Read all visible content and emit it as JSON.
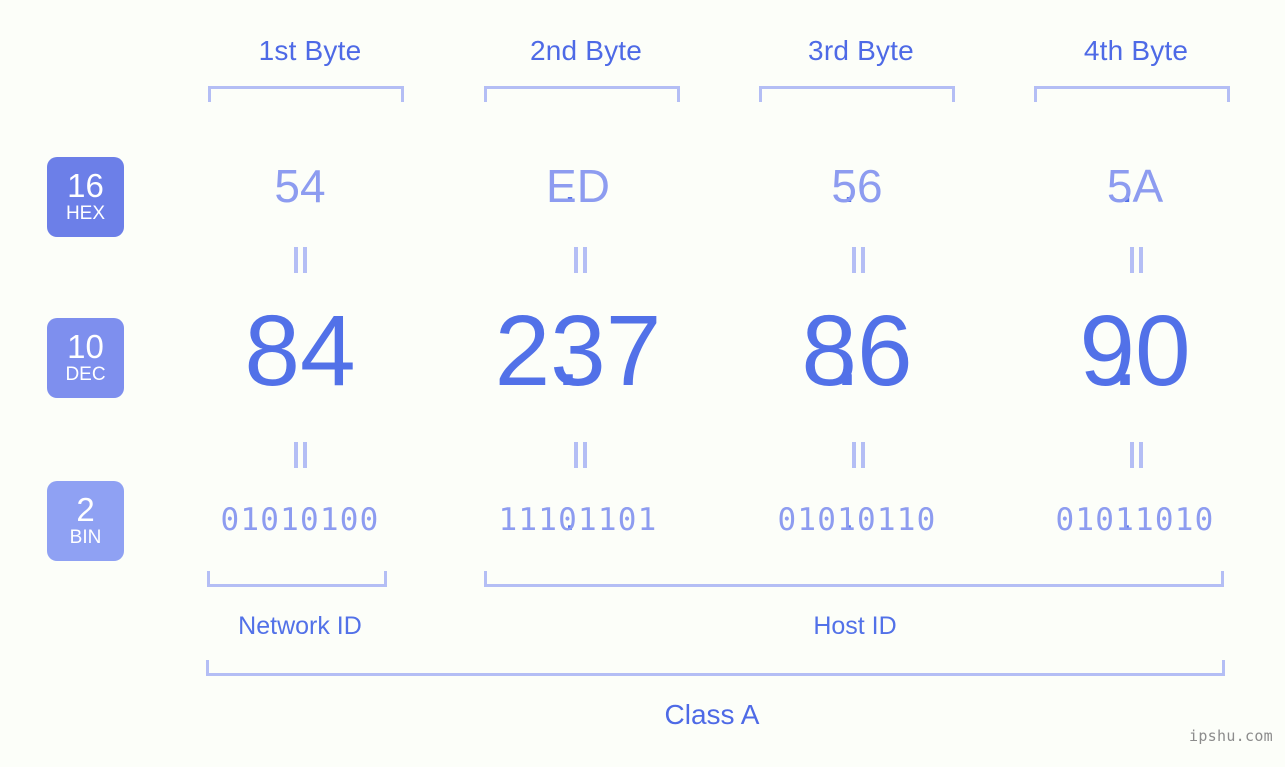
{
  "background_color": "#fcfef9",
  "accent_color": "#5271e8",
  "accent_light_color": "#8d9cf0",
  "bracket_color": "#b4bef5",
  "header": {
    "bytes": [
      {
        "label": "1st Byte"
      },
      {
        "label": "2nd Byte"
      },
      {
        "label": "3rd Byte"
      },
      {
        "label": "4th Byte"
      }
    ]
  },
  "badges": [
    {
      "number": "16",
      "name": "HEX",
      "color": "#6c7fe8"
    },
    {
      "number": "10",
      "name": "DEC",
      "color": "#7e8fee"
    },
    {
      "number": "2",
      "name": "BIN",
      "color": "#8fa1f3"
    }
  ],
  "rows": {
    "hex": {
      "base": "16",
      "base_name": "HEX",
      "octets": [
        "54",
        "ED",
        "56",
        "5A"
      ],
      "separator": "."
    },
    "dec": {
      "base": "10",
      "base_name": "DEC",
      "octets": [
        "84",
        "237",
        "86",
        "90"
      ],
      "separator": "."
    },
    "bin": {
      "base": "2",
      "base_name": "BIN",
      "octets": [
        "01010100",
        "11101101",
        "01010110",
        "01011010"
      ],
      "separator": "."
    }
  },
  "connectors": {
    "glyph": "=",
    "count_per_row": 4
  },
  "footer": {
    "network_id_label": "Network ID",
    "host_id_label": "Host ID",
    "class_label": "Class A"
  },
  "watermark": "ipshu.com"
}
